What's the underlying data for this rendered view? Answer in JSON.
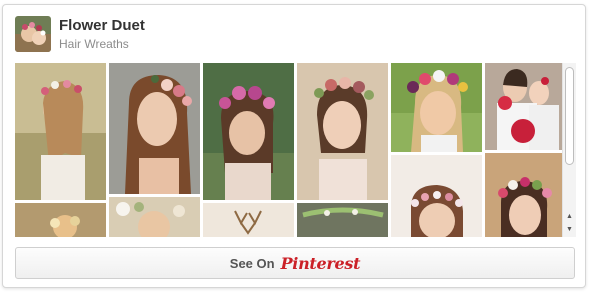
{
  "board": {
    "title": "Flower Duet",
    "subtitle": "Hair Wreaths"
  },
  "footer": {
    "see_on_label": "See On",
    "brand": "Pinterest"
  },
  "colors": {
    "brand_red": "#cb2027",
    "title_text": "#333333",
    "subtitle_text": "#8c8c8c"
  },
  "icons": {
    "scroll_up": "▲",
    "scroll_down": "▼"
  }
}
